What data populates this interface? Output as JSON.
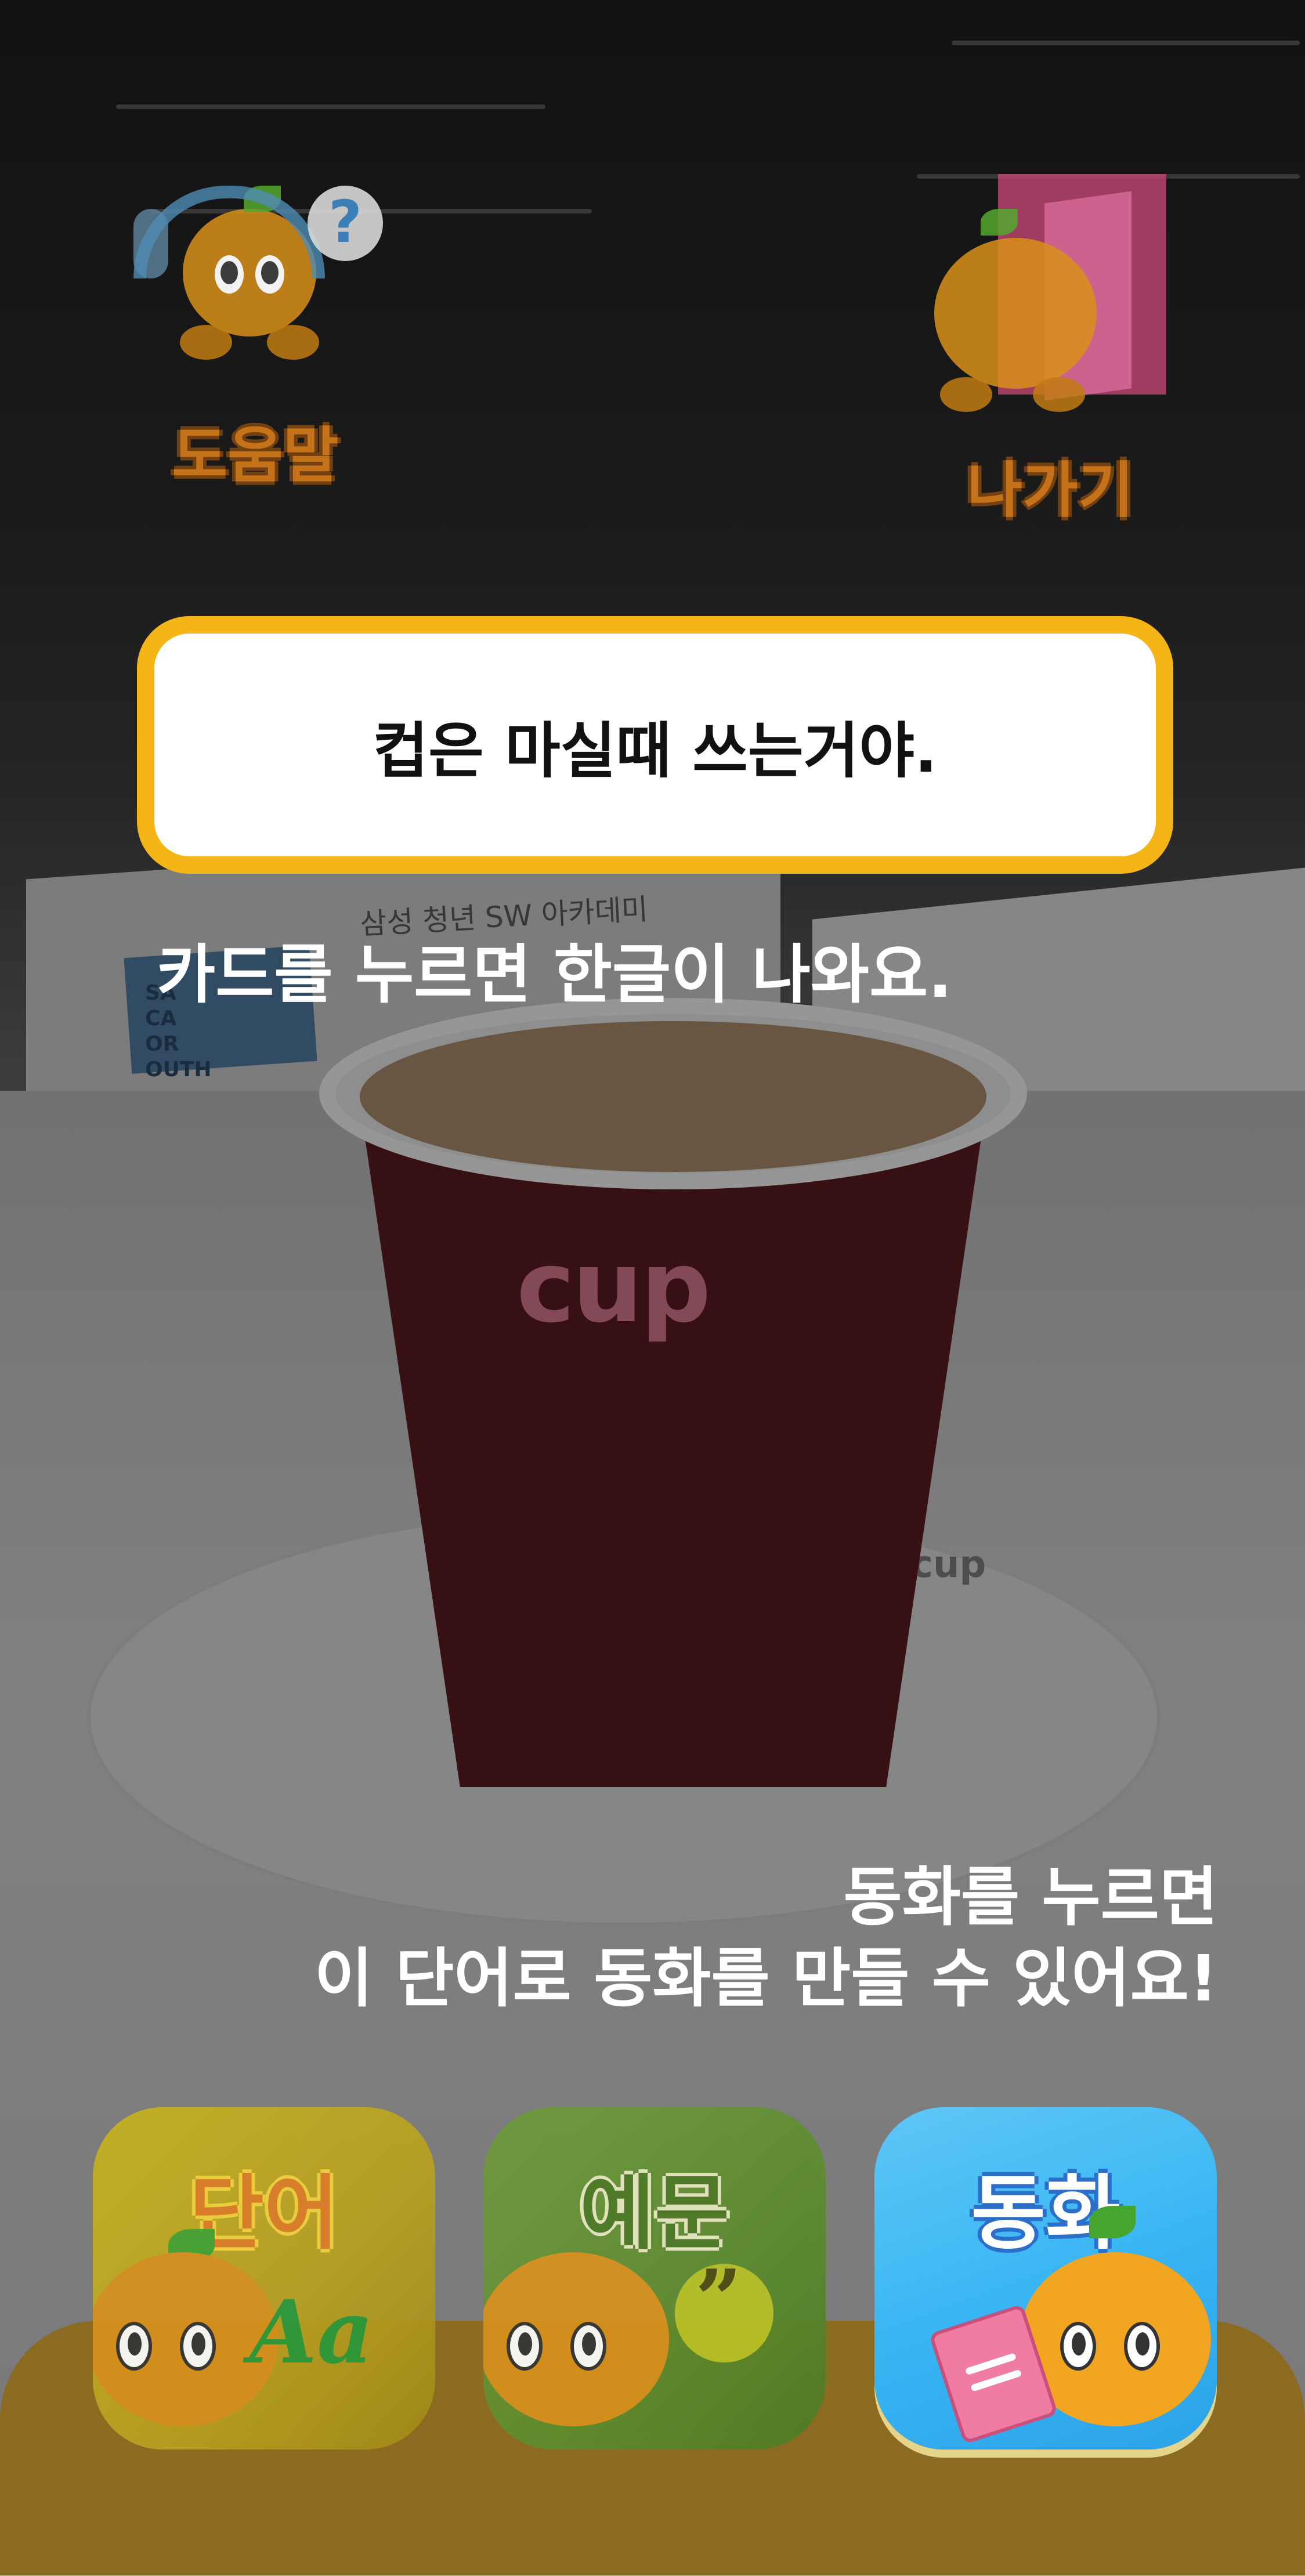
{
  "top": {
    "help_label": "도움말",
    "exit_label": "나가기",
    "help_icon_symbol": "?"
  },
  "message": {
    "text": "컵은 마실때 쓰는거야."
  },
  "hints": {
    "card_hint": "카드를 누르면 한글이 나와요.",
    "story_hint_line1": "동화를 누르면",
    "story_hint_line2": "이 단어로 동화를 만들 수 있어요!"
  },
  "background": {
    "cup_label": "cup",
    "saucer_label": "cup",
    "sign_text": "삼성 청년 SW 아카데미",
    "blue_card_lines": [
      "SA",
      "CA",
      "OR",
      "OUTH"
    ]
  },
  "tiles": {
    "word": {
      "label": "단어",
      "glyph": "Aa"
    },
    "example": {
      "label": "예문",
      "glyph": "”"
    },
    "story": {
      "label": "동화"
    }
  },
  "colors": {
    "message_border": "#f6b516",
    "story_tile": "#3ab6f4",
    "word_tile": "#c9b31f",
    "example_tile": "#6f9b3c"
  }
}
